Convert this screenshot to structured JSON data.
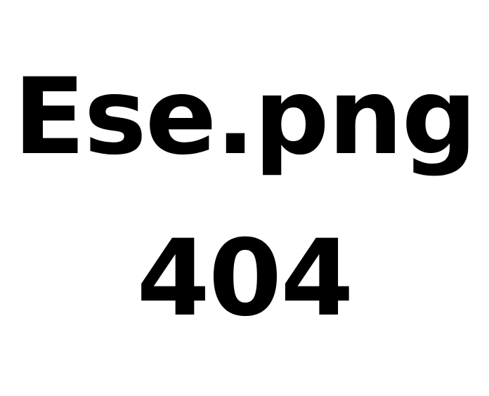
{
  "message": {
    "filename": "Ese.png",
    "code": "404"
  },
  "colors": {
    "background": "#ffffff",
    "text": "#000000"
  }
}
